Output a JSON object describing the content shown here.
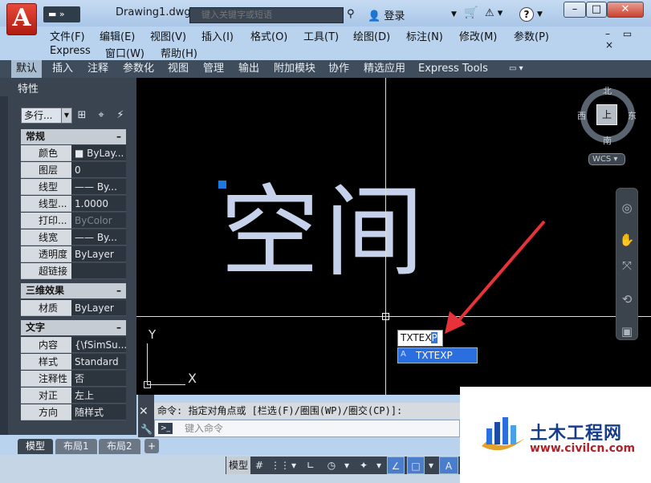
{
  "window": {
    "doc_title": "Drawing1.dwg",
    "search_placeholder": "键入关键字或短语",
    "login_label": "登录",
    "help_label": "?",
    "app_letter": "A",
    "minimize": "–",
    "maximize": "□",
    "close": "✕",
    "mdi_controls": "– ▭ ×"
  },
  "menu": {
    "items": [
      "文件(F)",
      "编辑(E)",
      "视图(V)",
      "插入(I)",
      "格式(O)",
      "工具(T)",
      "绘图(D)",
      "标注(N)",
      "修改(M)",
      "参数(P)"
    ],
    "items_row2": [
      "Express",
      "窗口(W)",
      "帮助(H)"
    ]
  },
  "ribbon": {
    "tabs": [
      "默认",
      "插入",
      "注释",
      "参数化",
      "视图",
      "管理",
      "输出",
      "附加模块",
      "协作",
      "精选应用",
      "Express Tools"
    ],
    "active_index": 0
  },
  "properties": {
    "title": "特性",
    "object_select": "多行...",
    "sections": [
      {
        "title": "常规",
        "rows": [
          {
            "k": "颜色",
            "v": "■ ByLay..."
          },
          {
            "k": "图层",
            "v": "0"
          },
          {
            "k": "线型",
            "v": "—— By..."
          },
          {
            "k": "线型...",
            "v": "1.0000"
          },
          {
            "k": "打印...",
            "v": "ByColor",
            "dim": true
          },
          {
            "k": "线宽",
            "v": "—— By..."
          },
          {
            "k": "透明度",
            "v": "ByLayer"
          },
          {
            "k": "超链接",
            "v": ""
          }
        ]
      },
      {
        "title": "三维效果",
        "rows": [
          {
            "k": "材质",
            "v": "ByLayer"
          }
        ]
      },
      {
        "title": "文字",
        "rows": [
          {
            "k": "内容",
            "v": "{\\fSimSu..."
          },
          {
            "k": "样式",
            "v": "Standard"
          },
          {
            "k": "注释性",
            "v": "否"
          },
          {
            "k": "对正",
            "v": "左上"
          },
          {
            "k": "方向",
            "v": "随样式"
          }
        ]
      }
    ]
  },
  "canvas": {
    "text": "空间",
    "ucs_y": "Y",
    "ucs_x": "X",
    "viewcube": {
      "north": "北",
      "south": "南",
      "east": "东",
      "west": "西",
      "face": "上"
    },
    "wcs_label": "WCS ▾",
    "dyn_input_typed": "TXTEX",
    "dyn_input_selected": "P",
    "autocomplete": "TXTEXP"
  },
  "command": {
    "history": "命令: 指定对角点或 [栏选(F)/圈围(WP)/圈交(CP)]:",
    "placeholder": "键入命令",
    "prompt_icon": ">_"
  },
  "layout_tabs": [
    "模型",
    "布局1",
    "布局2"
  ],
  "layout_add": "+",
  "status": {
    "model": "模型",
    "buttons": [
      "#",
      "⋮⋮",
      "▾",
      "∟",
      "◷",
      "▾",
      "✦",
      "▾",
      "∠",
      "□",
      "▾",
      "A"
    ]
  },
  "watermark": {
    "title": "土木工程网",
    "url": "www.civilcn.com"
  },
  "colors": {
    "canvas_bg": "#000000",
    "text_color": "#c6d2ec",
    "arrow": "#e8323a",
    "accent": "#2a6ee0"
  }
}
